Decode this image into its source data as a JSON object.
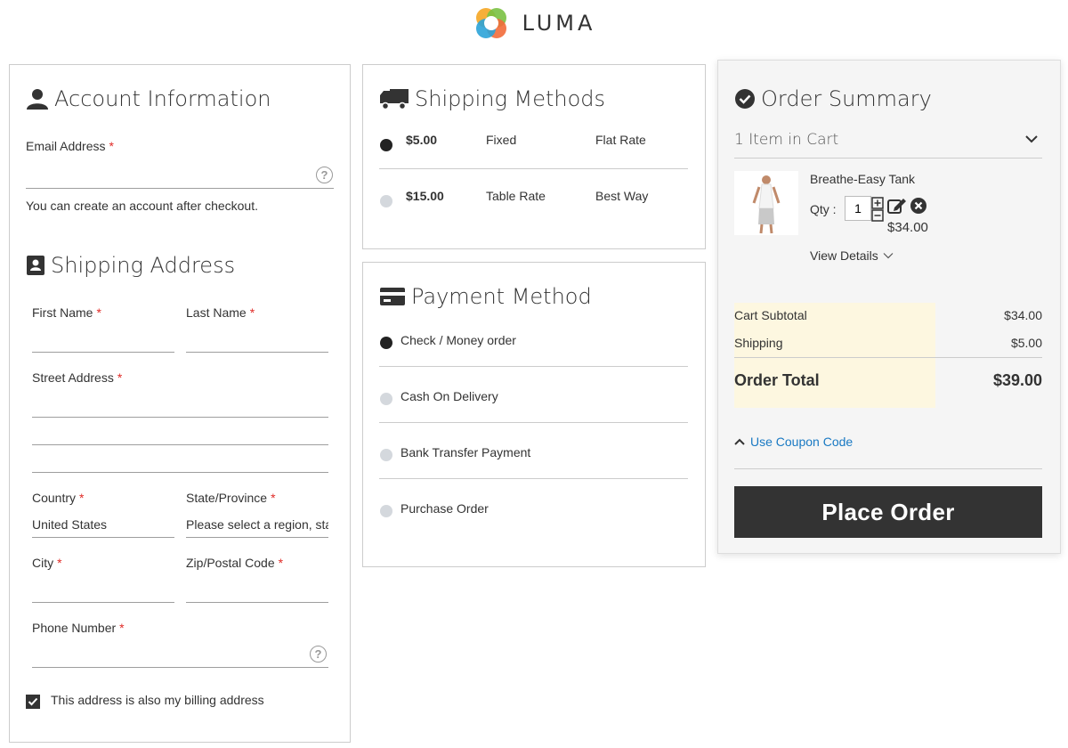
{
  "header": {
    "logo_text": "LUMA"
  },
  "account": {
    "title": "Account Information",
    "email_label": "Email Address",
    "email_value": "",
    "note": "You can create an account after checkout."
  },
  "shipping_address": {
    "title": "Shipping Address",
    "first_name_label": "First Name",
    "last_name_label": "Last Name",
    "street_label": "Street Address",
    "country_label": "Country",
    "country_value": "United States",
    "state_label": "State/Province",
    "state_value": "Please select a region, sta",
    "city_label": "City",
    "zip_label": "Zip/Postal Code",
    "phone_label": "Phone Number",
    "billing_same_label": "This address is also my billing address",
    "billing_same_checked": true
  },
  "shipping_methods": {
    "title": "Shipping Methods",
    "options": [
      {
        "price": "$5.00",
        "method": "Fixed",
        "carrier": "Flat Rate",
        "selected": true
      },
      {
        "price": "$15.00",
        "method": "Table Rate",
        "carrier": "Best Way",
        "selected": false
      }
    ]
  },
  "payment": {
    "title": "Payment Method",
    "options": [
      {
        "label": "Check / Money order",
        "selected": true
      },
      {
        "label": "Cash On Delivery",
        "selected": false
      },
      {
        "label": "Bank Transfer Payment",
        "selected": false
      },
      {
        "label": "Purchase Order",
        "selected": false
      }
    ]
  },
  "summary": {
    "title": "Order Summary",
    "items_in_cart": "1 Item in Cart",
    "item": {
      "name": "Breathe-Easy Tank",
      "qty_label": "Qty :",
      "qty": "1",
      "price": "$34.00",
      "view_details": "View Details"
    },
    "totals": {
      "subtotal_label": "Cart Subtotal",
      "subtotal": "$34.00",
      "shipping_label": "Shipping",
      "shipping": "$5.00",
      "total_label": "Order Total",
      "total": "$39.00"
    },
    "coupon_label": "Use Coupon Code",
    "place_order": "Place Order"
  },
  "colors": {
    "accent_link": "#1979c3",
    "required": "#e02b27",
    "button_bg": "#333333",
    "totals_highlight": "#fdf7e0"
  }
}
